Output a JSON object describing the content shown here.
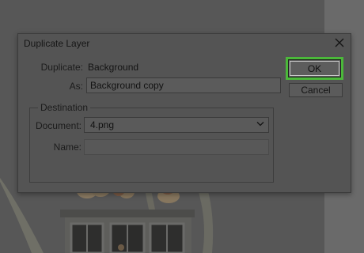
{
  "dialog": {
    "title": "Duplicate Layer",
    "duplicate_label": "Duplicate:",
    "duplicate_value": "Background",
    "as_label": "As:",
    "as_value": "Background copy",
    "destination_legend": "Destination",
    "document_label": "Document:",
    "document_value": "4.png",
    "name_label": "Name:",
    "name_value": "",
    "ok_label": "OK",
    "cancel_label": "Cancel"
  },
  "colors": {
    "highlight": "#4bb83a"
  },
  "icons": {
    "close": "close-icon",
    "dropdown": "chevron-down-icon"
  }
}
